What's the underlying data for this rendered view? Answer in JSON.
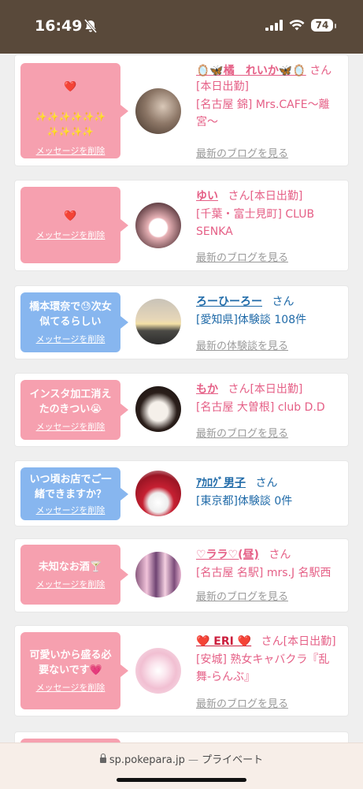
{
  "status": {
    "time": "16:49",
    "battery": "74"
  },
  "feed": [
    {
      "message_emoji_top": "❤️",
      "message_emoji_bottom": "✨✨✨✨✨✨\n✨✨✨✨",
      "delete_label": "メッセージを削除",
      "name": "🪞🦋橘　れいか🦋🪞",
      "san": "さん",
      "status": "[本日出勤]",
      "shop": "[名古屋 錦] Mrs.CAFE〜離宮〜",
      "link": "最新のブログを見る"
    },
    {
      "message": "❤️",
      "delete_label": "メッセージを削除",
      "name": "ゆい",
      "san": "さん",
      "status": "[本日出勤]",
      "shop": "[千葉・富士見町] CLUB SENKA",
      "link": "最新のブログを見る"
    },
    {
      "message": "橋本環奈で😓次女似てるらしい",
      "delete_label": "メッセージを削除",
      "name": "ろーひーろー",
      "san": "さん",
      "shop": "[愛知県]体験談 108件",
      "link": "最新の体験談を見る"
    },
    {
      "message": "インスタ加工消えたのきつい😭",
      "delete_label": "メッセージを削除",
      "name": "もか",
      "san": "さん",
      "status": "[本日出勤]",
      "shop": "[名古屋 大曽根] club D.D",
      "link": "最新のブログを見る"
    },
    {
      "message": "いつ頃お店でご一緒できますか？",
      "delete_label": "メッセージを削除",
      "name": "ｱｶﾛｸﾞ男子",
      "san": "さん",
      "shop": "[東京都]体験談 0件"
    },
    {
      "message": "未知なお酒🍸",
      "delete_label": "メッセージを削除",
      "name": "♡ララ♡(昼)",
      "san": "さん",
      "shop": "[名古屋 名駅] mrs.J 名駅西",
      "link": "最新のブログを見る"
    },
    {
      "message": "可愛いから盛る必要ないです💗",
      "delete_label": "メッセージを削除",
      "name": "❤️ ERI ❤️",
      "san": "さん",
      "status": "[本日出勤]",
      "shop": "[安城] 熟女キャバクラ『乱舞-らんぶ』",
      "link": "最新のブログを見る"
    }
  ],
  "browser": {
    "url": "sp.pokepara.jp",
    "separator": " — ",
    "mode": "プライベート"
  }
}
